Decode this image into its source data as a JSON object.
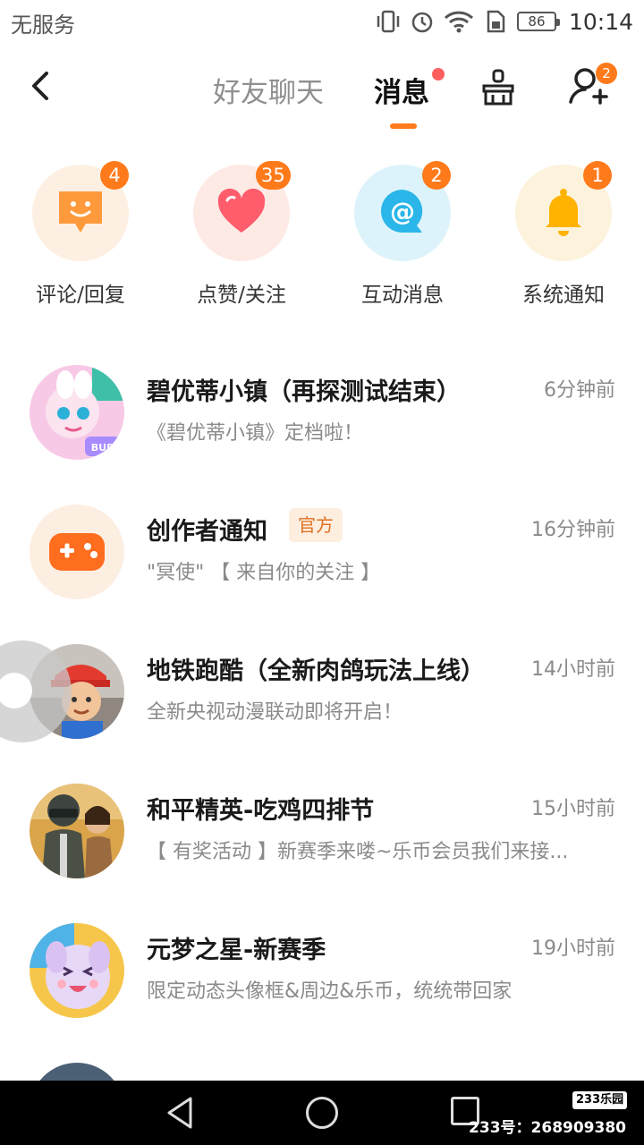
{
  "status_bar": {
    "carrier": "无服务",
    "battery": "86",
    "time": "10:14"
  },
  "header": {
    "tab_friends": "好友聊天",
    "tab_messages": "消息",
    "add_friend_badge": "2"
  },
  "quick_actions": [
    {
      "label": "评论/回复",
      "badge": "4",
      "icon": "smile-chat-icon",
      "color": "#ff9a3c",
      "bg": "#fdf0e3"
    },
    {
      "label": "点赞/关注",
      "badge": "35",
      "icon": "heart-icon",
      "color": "#ff5c6c",
      "bg": "#fdeae5"
    },
    {
      "label": "互动消息",
      "badge": "2",
      "icon": "at-chat-icon",
      "color": "#2ab6e8",
      "bg": "#ddf3fb"
    },
    {
      "label": "系统通知",
      "badge": "1",
      "icon": "bell-icon",
      "color": "#ffb300",
      "bg": "#fdf3dc"
    }
  ],
  "messages": [
    {
      "title": "碧优蒂小镇（再探测试结束）",
      "time": "6分钟前",
      "preview": "《碧优蒂小镇》定档啦！",
      "avatar": "game-avatar-bud-town"
    },
    {
      "title": "创作者通知",
      "tag": "官方",
      "time": "16分钟前",
      "preview": "\"冥使\" 【 来自你的关注 】",
      "avatar": "gamepad-icon"
    },
    {
      "title": "地铁跑酷（全新肉鸽玩法上线）",
      "time": "14小时前",
      "preview": "全新央视动漫联动即将开启！",
      "avatar": "game-avatar-subway-surfers"
    },
    {
      "title": "和平精英-吃鸡四排节",
      "time": "15小时前",
      "preview": "【 有奖活动 】新赛季来喽~乐币会员我们来接...",
      "avatar": "game-avatar-peacekeeper"
    },
    {
      "title": "元梦之星-新赛季",
      "time": "19小时前",
      "preview": "限定动态头像框&周边&乐币，统统带回家",
      "avatar": "game-avatar-dream-star"
    }
  ],
  "watermark": {
    "logo": "233乐园",
    "text": "233号：268909380"
  },
  "colors": {
    "accent": "#ff7a1a",
    "dot": "#ff5e5e"
  }
}
